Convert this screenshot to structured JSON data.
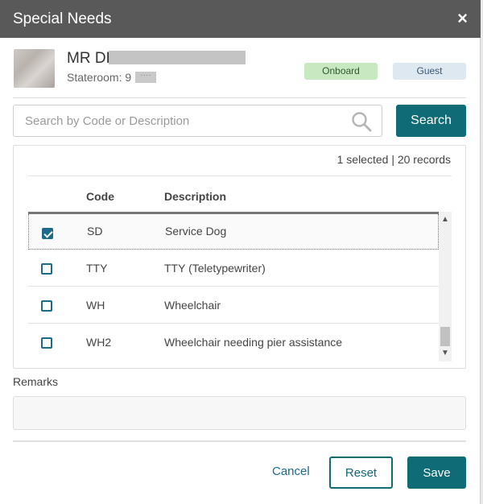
{
  "dialog": {
    "title": "Special Needs",
    "close_glyph": "×"
  },
  "guest": {
    "name": "MR DI",
    "stateroom": "Stateroom: 9",
    "room_mask": "····",
    "status_badge": "Onboard",
    "type_badge": "Guest"
  },
  "search": {
    "placeholder": "Search by Code or Description",
    "value": "",
    "button_label": "Search",
    "icon": "search-icon"
  },
  "table": {
    "summary": "1 selected | 20 records",
    "columns": [
      "Code",
      "Description"
    ],
    "rows": [
      {
        "code": "SD",
        "description": "Service Dog",
        "checked": true
      },
      {
        "code": "TTY",
        "description": "TTY (Teletypewriter)",
        "checked": false
      },
      {
        "code": "WH",
        "description": "Wheelchair",
        "checked": false
      },
      {
        "code": "WH2",
        "description": "Wheelchair needing pier assistance",
        "checked": false
      }
    ]
  },
  "remarks": {
    "label": "Remarks",
    "value": ""
  },
  "footer": {
    "cancel_label": "Cancel",
    "reset_label": "Reset",
    "save_label": "Save"
  },
  "colors": {
    "header_bg": "#595959",
    "accent": "#0f6b75",
    "checkbox": "#1d6a8a",
    "onboard_badge": "#c8e8c2",
    "guest_badge": "#dde8f1"
  }
}
